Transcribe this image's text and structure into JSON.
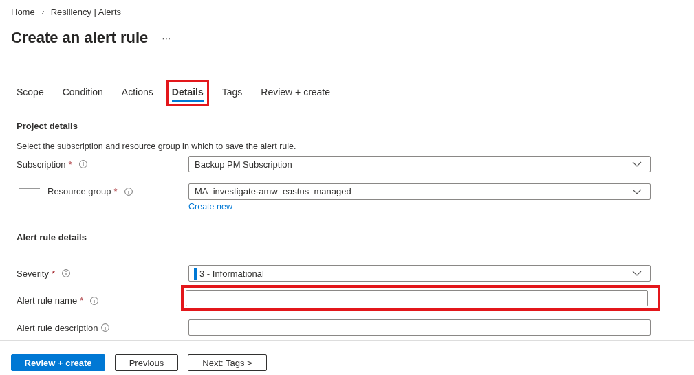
{
  "breadcrumb": [
    "Home",
    "Resiliency | Alerts"
  ],
  "title": "Create an alert rule",
  "more_button": "···",
  "tabs": [
    {
      "label": "Scope",
      "selected": false,
      "highlighted": false
    },
    {
      "label": "Condition",
      "selected": false,
      "highlighted": false
    },
    {
      "label": "Actions",
      "selected": false,
      "highlighted": false
    },
    {
      "label": "Details",
      "selected": true,
      "highlighted": true
    },
    {
      "label": "Tags",
      "selected": false,
      "highlighted": false
    },
    {
      "label": "Review + create",
      "selected": false,
      "highlighted": false
    }
  ],
  "sections": [
    {
      "heading": "Project details",
      "description": "Select the subscription and resource group in which to save the alert rule.",
      "fields": [
        {
          "label": "Subscription",
          "required_mark": "*",
          "kind": "dropdown",
          "value": "Backup PM Subscription",
          "highlighted": false,
          "children": [
            {
              "label": "Resource group",
              "required_mark": "*",
              "kind": "dropdown",
              "value": "MA_investigate-amw_eastus_managed",
              "highlighted": false,
              "link": "Create new"
            }
          ]
        }
      ]
    },
    {
      "heading": "Alert rule details",
      "fields": [
        {
          "label": "Severity",
          "required_mark": "*",
          "kind": "dropdown",
          "value": "3 - Informational",
          "color": "#0078d4",
          "highlighted": false
        },
        {
          "label": "Alert rule name",
          "required_mark": "*",
          "kind": "text",
          "highlighted": true
        },
        {
          "label": "Alert rule description",
          "kind": "text",
          "highlighted": false
        }
      ]
    }
  ],
  "footer_buttons": [
    {
      "label": "Review + create",
      "kind": "primary"
    },
    {
      "label": "Previous",
      "kind": "secondary"
    },
    {
      "label": "Next: Tags >",
      "kind": "secondary"
    }
  ]
}
